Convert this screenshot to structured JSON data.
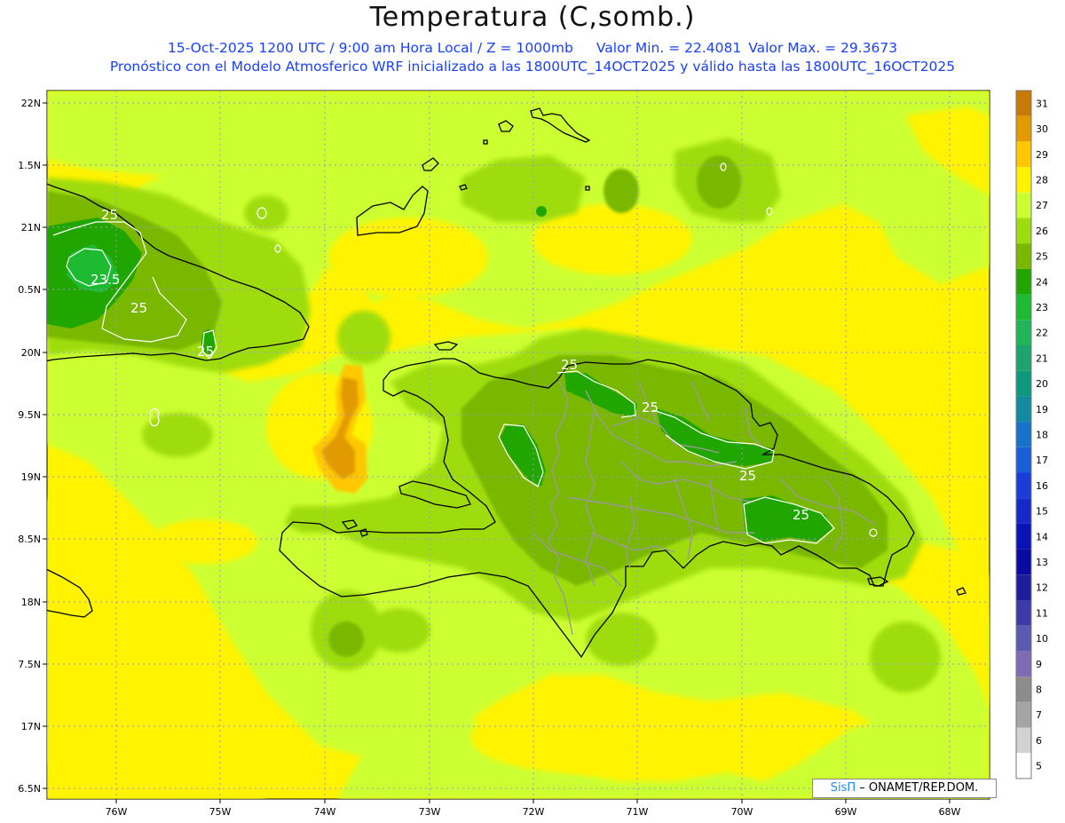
{
  "header": {
    "title": "Temperatura (C,somb.)",
    "datetime": "15-Oct-2025  1200 UTC / 9:00 am Hora Local / Z = 1000mb",
    "min_label": "Valor Min. = 22.4081",
    "max_label": "Valor Max. = 29.3673",
    "forecast_info": "Pronóstico con el Modelo Atmosferico WRF inicializado a las 1800UTC_14OCT2025 y válido hasta las  1800UTC_16OCT2025"
  },
  "axes": {
    "lat_labels": [
      "22N",
      "1.5N",
      "21N",
      "0.5N",
      "20N",
      "9.5N",
      "19N",
      "8.5N",
      "18N",
      "7.5N",
      "17N",
      "6.5N"
    ],
    "lon_labels": [
      "76W",
      "75W",
      "74W",
      "73W",
      "72W",
      "71W",
      "70W",
      "69W",
      "68W"
    ]
  },
  "colorbar": {
    "labels": [
      "31",
      "30",
      "29",
      "28",
      "27",
      "26",
      "25",
      "24",
      "23",
      "22",
      "21",
      "20",
      "19",
      "18",
      "17",
      "16",
      "15",
      "14",
      "13",
      "12",
      "11",
      "10",
      "9",
      "8",
      "7",
      "6",
      "5"
    ],
    "colors": [
      "#c87a05",
      "#e19b00",
      "#ffc800",
      "#fff300",
      "#ccff33",
      "#9fdc0f",
      "#7ab800",
      "#21a600",
      "#1ebb32",
      "#22b45a",
      "#1fa36e",
      "#10987f",
      "#148aa0",
      "#1673c8",
      "#1a5fd8",
      "#1a3cd8",
      "#1528c8",
      "#0a14b4",
      "#0a0aa0",
      "#1e1e9a",
      "#3c3ca8",
      "#5a5ab0",
      "#7f6ab4",
      "#8c8c8c",
      "#a5a5a5",
      "#d2d2d2",
      "#ffffff"
    ]
  },
  "contour_labels": [
    "25",
    "23.5",
    "25",
    "25",
    "25",
    "25",
    "25",
    "25"
  ],
  "credit": {
    "brand": "SisΠ",
    "org": " – ONAMET/REP.DOM."
  },
  "colors": {
    "sea_yellow": "#fff300",
    "lime": "#ccff33",
    "coastline": "#000000",
    "borders": "#999999",
    "title_blue": "#1a40ff"
  }
}
